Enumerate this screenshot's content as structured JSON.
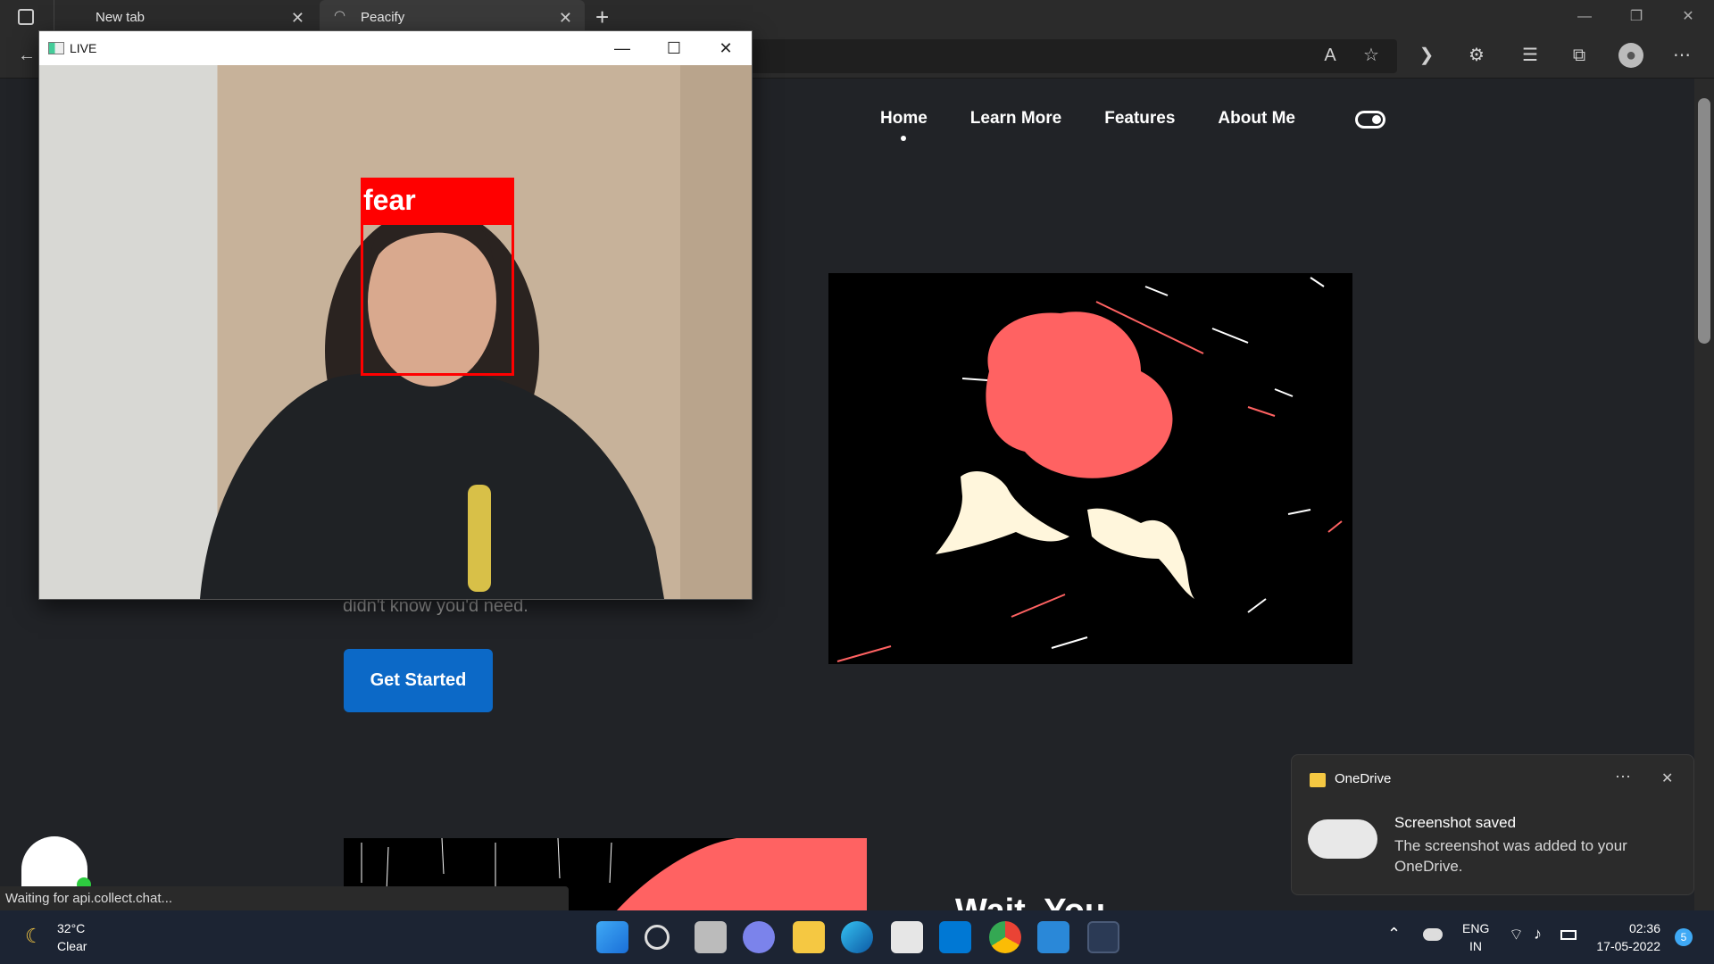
{
  "browser": {
    "tabs": [
      {
        "label": "New tab"
      },
      {
        "label": "Peacify"
      }
    ]
  },
  "site": {
    "nav": [
      "Home",
      "Learn More",
      "Features",
      "About Me"
    ],
    "hero_text": "didn't know you'd need.",
    "cta_label": "Get Started",
    "section_heading": "Wait, You"
  },
  "status": {
    "text": "Waiting for api.collect.chat..."
  },
  "live_window": {
    "title": "LIVE",
    "emotion_label": "fear"
  },
  "toast": {
    "app": "OneDrive",
    "title": "Screenshot saved",
    "body": "The screenshot was added to your OneDrive."
  },
  "taskbar": {
    "weather_temp": "32°C",
    "weather_desc": "Clear",
    "lang_line1": "ENG",
    "lang_line2": "IN",
    "time": "02:36",
    "date": "17-05-2022",
    "notification_count": "5"
  },
  "colors": {
    "accent": "#0c69c7",
    "detect_red": "#ff0000",
    "illustration_red": "#ff6262"
  }
}
